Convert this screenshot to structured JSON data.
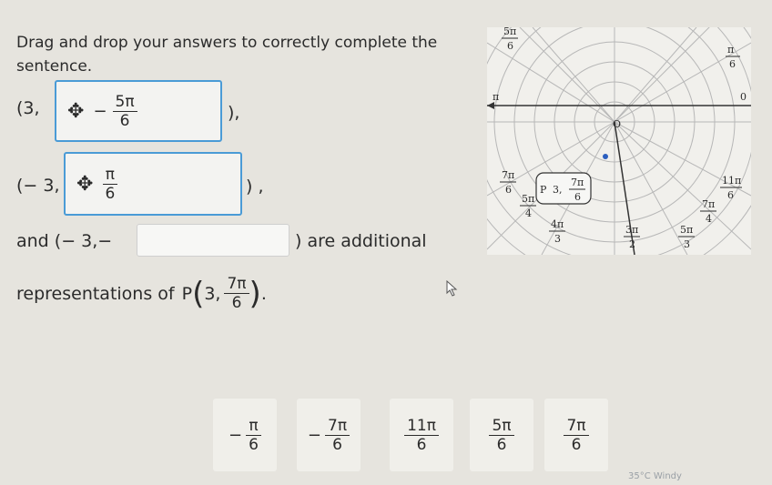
{
  "prompt": {
    "line1": "Drag and drop your answers to correctly complete the",
    "line2": "sentence."
  },
  "row1": {
    "open": "(3,",
    "close": "),",
    "sign": "−",
    "num": "5π",
    "den": "6"
  },
  "row2": {
    "open": "(− 3,",
    "close": ") ,",
    "num": "π",
    "den": "6"
  },
  "row3": {
    "prefix": "and (− 3,−",
    "suffix": ") are additional"
  },
  "row4": {
    "text": "representations of",
    "point": "P",
    "coord": "3,",
    "num": "7π",
    "den": "6"
  },
  "tiles": [
    {
      "sign": "−",
      "num": "π",
      "den": "6"
    },
    {
      "sign": "−",
      "num": "7π",
      "den": "6"
    },
    {
      "sign": "",
      "num": "11π",
      "den": "6"
    },
    {
      "sign": "",
      "num": "5π",
      "den": "6"
    },
    {
      "sign": "",
      "num": "7π",
      "den": "6"
    }
  ],
  "polar": {
    "labels": {
      "a5pi6": {
        "num": "5π",
        "den": "6"
      },
      "api6": {
        "num": "π",
        "den": "6"
      },
      "api": "π",
      "azero": "0",
      "center": "O",
      "a7pi6": {
        "num": "7π",
        "den": "6"
      },
      "a11pi6": {
        "num": "11π",
        "den": "6"
      },
      "a5pi4": {
        "num": "5π",
        "den": "4"
      },
      "a7pi4": {
        "num": "7π",
        "den": "4"
      },
      "a4pi3": {
        "num": "4π",
        "den": "3"
      },
      "a3pi2": {
        "num": "3π",
        "den": "2"
      },
      "a5pi3": {
        "num": "5π",
        "den": "3"
      },
      "pointP": {
        "name": "P",
        "coord": "3,",
        "num": "7π",
        "den": "6"
      }
    }
  },
  "taskbar": {
    "weather": "35°C Windy"
  }
}
